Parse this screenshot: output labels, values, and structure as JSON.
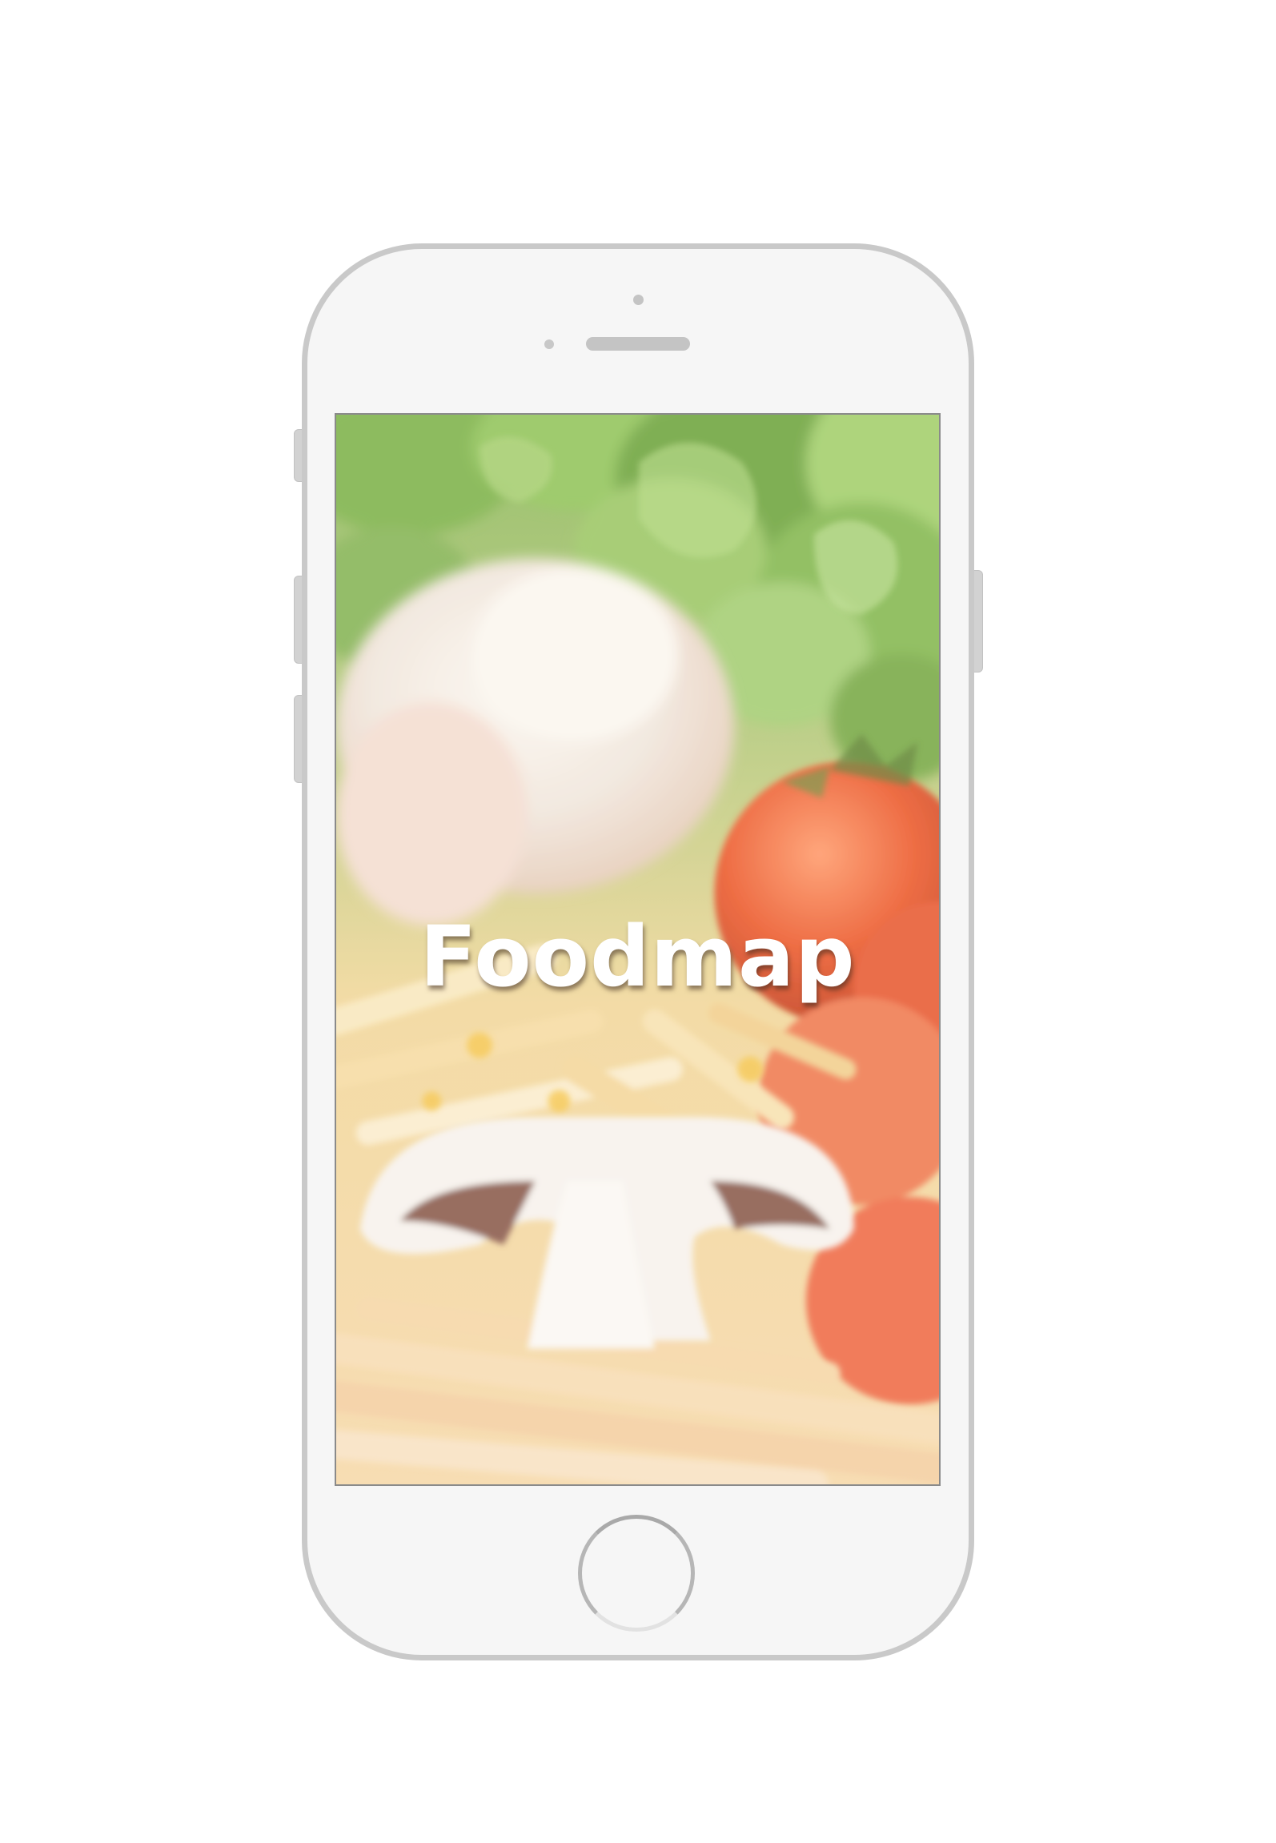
{
  "app": {
    "title": "Foodmap"
  },
  "splash": {
    "background": "food-photo-vegetables-tomato-mushroom-pasta"
  },
  "device": {
    "frame_color": "#c9c9c9",
    "body_color": "#f6f6f6"
  }
}
